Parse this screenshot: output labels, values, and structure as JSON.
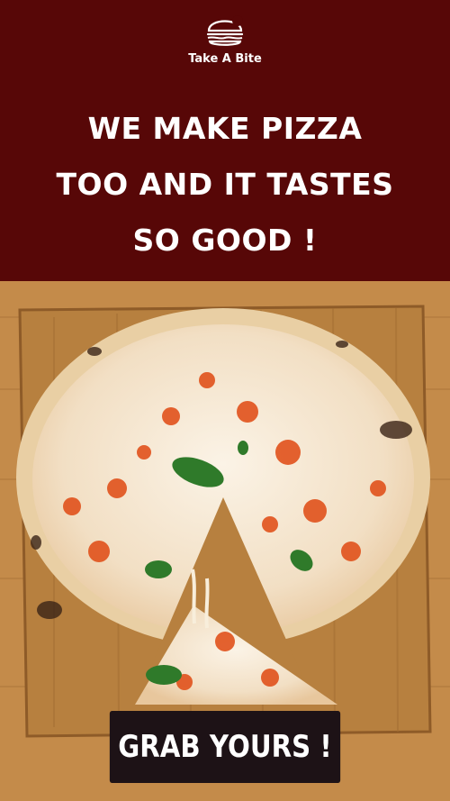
{
  "brand": {
    "name": "Take A Bite",
    "icon": "burger-bite-icon"
  },
  "headline": {
    "lines": [
      "WE MAKE PIZZA",
      "TOO AND IT TASTES",
      "SO GOOD !"
    ]
  },
  "photo": {
    "subject": "pizza-photo"
  },
  "cta": {
    "label": "GRAB YOURS !"
  },
  "colors": {
    "header_bg": "#570707",
    "cta_bg": "#1d1216",
    "text": "#ffffff"
  }
}
